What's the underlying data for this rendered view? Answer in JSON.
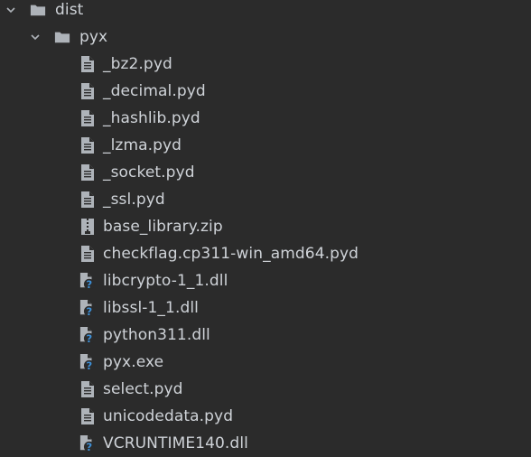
{
  "tree": {
    "root": {
      "label": "dist",
      "expanded": true,
      "icon": "folder-icon"
    },
    "folder": {
      "label": "pyx",
      "expanded": true,
      "icon": "folder-icon"
    },
    "files": [
      {
        "label": "_bz2.pyd",
        "icon": "text-file-icon"
      },
      {
        "label": "_decimal.pyd",
        "icon": "text-file-icon"
      },
      {
        "label": "_hashlib.pyd",
        "icon": "text-file-icon"
      },
      {
        "label": "_lzma.pyd",
        "icon": "text-file-icon"
      },
      {
        "label": "_socket.pyd",
        "icon": "text-file-icon"
      },
      {
        "label": "_ssl.pyd",
        "icon": "text-file-icon"
      },
      {
        "label": "base_library.zip",
        "icon": "archive-file-icon"
      },
      {
        "label": "checkflag.cp311-win_amd64.pyd",
        "icon": "text-file-icon"
      },
      {
        "label": "libcrypto-1_1.dll",
        "icon": "unknown-file-icon"
      },
      {
        "label": "libssl-1_1.dll",
        "icon": "unknown-file-icon"
      },
      {
        "label": "python311.dll",
        "icon": "unknown-file-icon"
      },
      {
        "label": "pyx.exe",
        "icon": "unknown-file-icon"
      },
      {
        "label": "select.pyd",
        "icon": "text-file-icon"
      },
      {
        "label": "unicodedata.pyd",
        "icon": "text-file-icon"
      },
      {
        "label": "VCRUNTIME140.dll",
        "icon": "unknown-file-icon"
      }
    ]
  },
  "colors": {
    "background": "#2b2b2b",
    "text": "#cfd3d8",
    "icon": "#aeb3b9",
    "unknown_badge": "#3d8fd6"
  }
}
